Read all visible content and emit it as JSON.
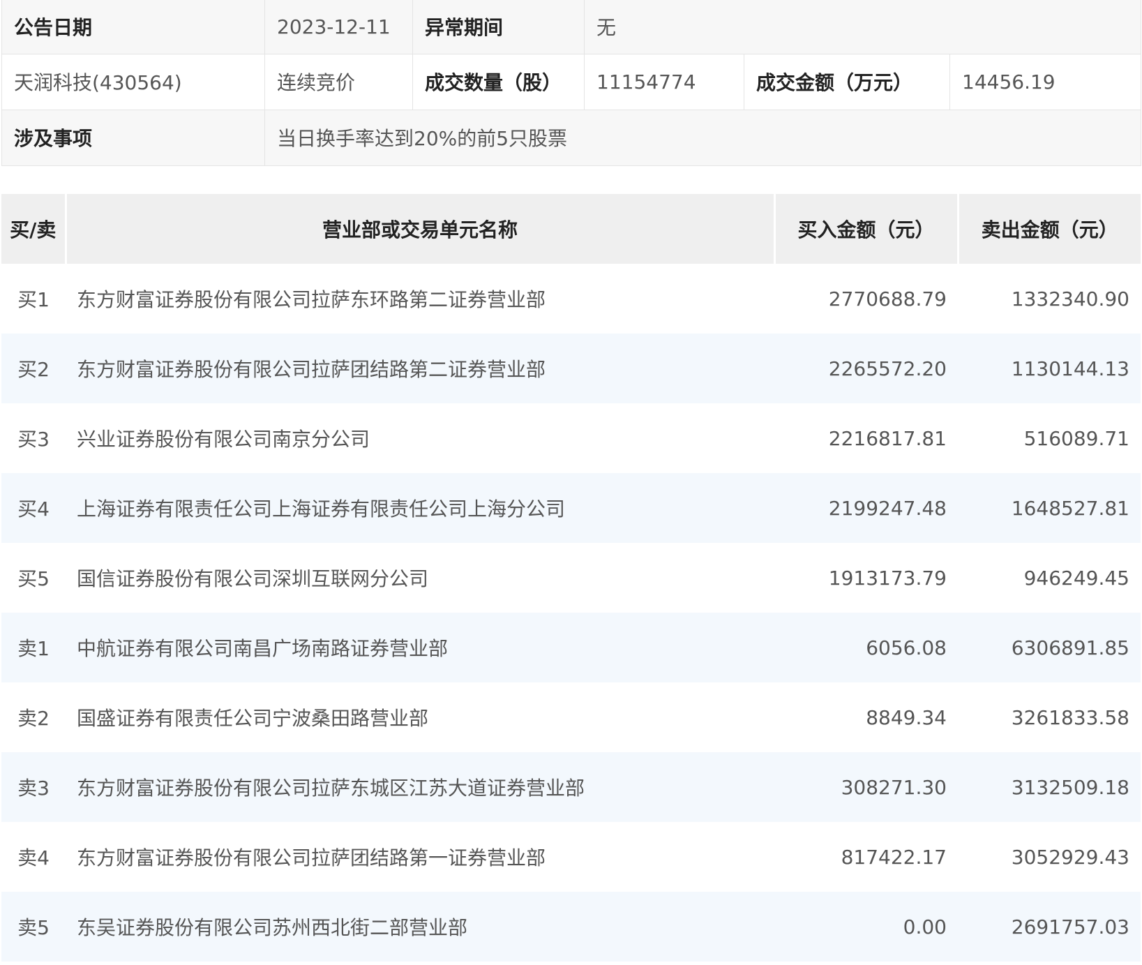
{
  "info": {
    "announce_date_label": "公告日期",
    "announce_date": "2023-12-11",
    "abnormal_period_label": "异常期间",
    "abnormal_period": "无",
    "stock": "天润科技(430564)",
    "trade_mode": "连续竞价",
    "volume_label": "成交数量（股）",
    "volume": "11154774",
    "amount_label": "成交金额（万元）",
    "amount": "14456.19",
    "matter_label": "涉及事项",
    "matter": "当日换手率达到20%的前5只股票"
  },
  "detail": {
    "headers": {
      "side": "买/卖",
      "name": "营业部或交易单元名称",
      "buy": "买入金额（元）",
      "sell": "卖出金额（元）"
    },
    "rows": [
      {
        "side": "买1",
        "name": "东方财富证券股份有限公司拉萨东环路第二证券营业部",
        "buy": "2770688.79",
        "sell": "1332340.90"
      },
      {
        "side": "买2",
        "name": "东方财富证券股份有限公司拉萨团结路第二证券营业部",
        "buy": "2265572.20",
        "sell": "1130144.13"
      },
      {
        "side": "买3",
        "name": "兴业证券股份有限公司南京分公司",
        "buy": "2216817.81",
        "sell": "516089.71"
      },
      {
        "side": "买4",
        "name": "上海证券有限责任公司上海证券有限责任公司上海分公司",
        "buy": "2199247.48",
        "sell": "1648527.81"
      },
      {
        "side": "买5",
        "name": "国信证券股份有限公司深圳互联网分公司",
        "buy": "1913173.79",
        "sell": "946249.45"
      },
      {
        "side": "卖1",
        "name": "中航证券有限公司南昌广场南路证券营业部",
        "buy": "6056.08",
        "sell": "6306891.85"
      },
      {
        "side": "卖2",
        "name": "国盛证券有限责任公司宁波桑田路营业部",
        "buy": "8849.34",
        "sell": "3261833.58"
      },
      {
        "side": "卖3",
        "name": "东方财富证券股份有限公司拉萨东城区江苏大道证券营业部",
        "buy": "308271.30",
        "sell": "3132509.18"
      },
      {
        "side": "卖4",
        "name": "东方财富证券股份有限公司拉萨团结路第一证券营业部",
        "buy": "817422.17",
        "sell": "3052929.43"
      },
      {
        "side": "卖5",
        "name": "东吴证券股份有限公司苏州西北街二部营业部",
        "buy": "0.00",
        "sell": "2691757.03"
      }
    ]
  }
}
